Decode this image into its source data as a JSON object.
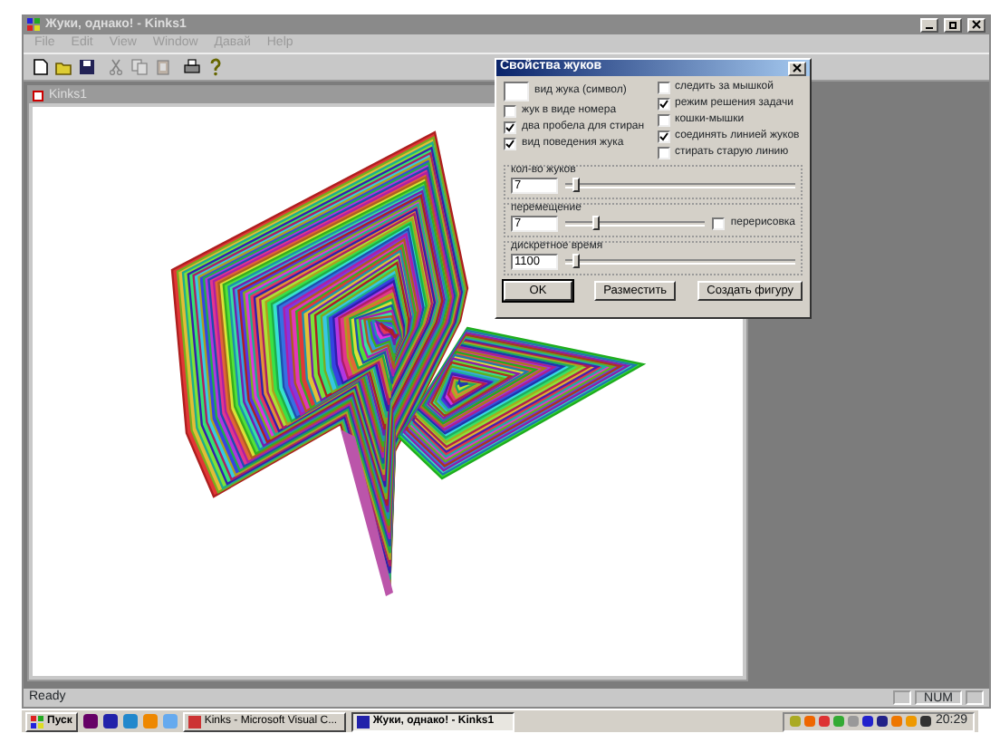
{
  "window": {
    "title": "Жуки, однако! - Kinks1"
  },
  "menu": [
    "File",
    "Edit",
    "View",
    "Window",
    "Давай",
    "Help"
  ],
  "toolbar": [
    {
      "kind": "new",
      "disabled": false
    },
    {
      "kind": "open",
      "disabled": false
    },
    {
      "kind": "save",
      "disabled": false
    },
    {
      "kind": "cut",
      "disabled": true
    },
    {
      "kind": "copy",
      "disabled": true
    },
    {
      "kind": "paste",
      "disabled": true
    },
    {
      "kind": "print",
      "disabled": false
    },
    {
      "kind": "help",
      "disabled": false
    }
  ],
  "child_window": {
    "title": "Kinks1"
  },
  "dialog": {
    "title": "Свойства жуков",
    "symbol_label": "вид жука (символ)",
    "options_left": [
      {
        "label": "жук в виде номера",
        "checked": false
      },
      {
        "label": "два пробела для стиран",
        "checked": true
      },
      {
        "label": "вид поведения жука",
        "checked": true
      }
    ],
    "options_right": [
      {
        "label": "следить за мышкой",
        "checked": false
      },
      {
        "label": "режим решения задачи",
        "checked": true
      },
      {
        "label": "кошки-мышки",
        "checked": false
      },
      {
        "label": "соединять линией жуков",
        "checked": true
      },
      {
        "label": "стирать старую линию",
        "checked": false
      }
    ],
    "groups": [
      {
        "title": "кол-во жуков",
        "value": "7",
        "level": 0.03
      },
      {
        "title": "перемещение",
        "value": "7",
        "level": 0.2,
        "option": {
          "label": "перерисовка",
          "checked": false
        }
      },
      {
        "title": "дискретное время",
        "value": "1100",
        "level": 0.03
      }
    ],
    "buttons": [
      {
        "label": "OK",
        "default": true
      },
      {
        "label": "Разместить",
        "default": false
      },
      {
        "label": "Создать фигуру",
        "default": false
      }
    ]
  },
  "status_bar": {
    "text": "Ready",
    "indicator": "NUM"
  },
  "taskbar": {
    "start": "Пуск",
    "tasks": [
      {
        "label": "Kinks - Microsoft Visual C...",
        "selected": false
      },
      {
        "label": "Жуки, однако! - Kinks1",
        "selected": true
      }
    ],
    "clock": "20:29"
  }
}
